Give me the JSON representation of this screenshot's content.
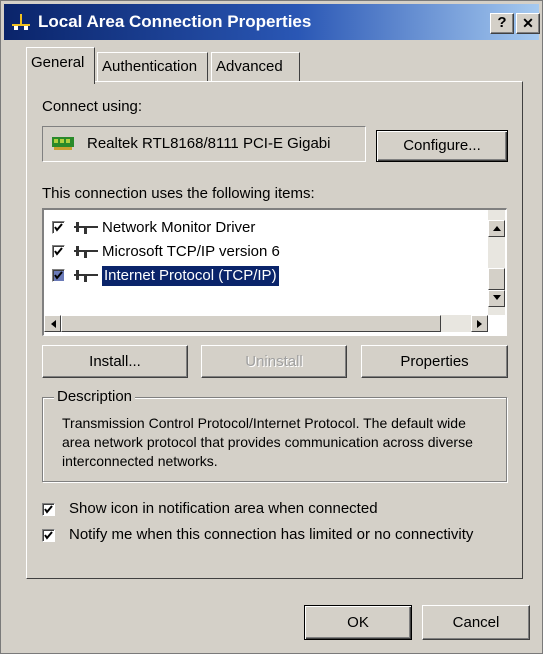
{
  "window": {
    "title": "Local Area Connection Properties",
    "help_button": "?",
    "close_button": "✕"
  },
  "tabs": [
    {
      "label": "General",
      "active": true
    },
    {
      "label": "Authentication",
      "active": false
    },
    {
      "label": "Advanced",
      "active": false
    }
  ],
  "connect_using": {
    "label": "Connect using:",
    "adapter": "Realtek RTL8168/8111 PCI-E Gigabi",
    "configure_button": "Configure..."
  },
  "items_section": {
    "label": "This connection uses the following items:",
    "items": [
      {
        "label": "Network Monitor Driver",
        "checked": true,
        "selected": false
      },
      {
        "label": "Microsoft TCP/IP version 6",
        "checked": true,
        "selected": false
      },
      {
        "label": "Internet Protocol (TCP/IP)",
        "checked": true,
        "selected": true
      }
    ]
  },
  "item_buttons": {
    "install": "Install...",
    "uninstall": "Uninstall",
    "properties": "Properties"
  },
  "description": {
    "title": "Description",
    "text": "Transmission Control Protocol/Internet Protocol. The default wide area network protocol that provides communication across diverse interconnected networks."
  },
  "options": {
    "show_icon": {
      "label": "Show icon in notification area when connected",
      "checked": true
    },
    "notify_me": {
      "label": "Notify me when this connection has limited or no connectivity",
      "checked": true
    }
  },
  "footer": {
    "ok": "OK",
    "cancel": "Cancel"
  },
  "colors": {
    "title_gradient_start": "#0a246a",
    "title_gradient_end": "#a6caf0",
    "dialog_face": "#d4d0c8",
    "selection": "#0a246a"
  }
}
